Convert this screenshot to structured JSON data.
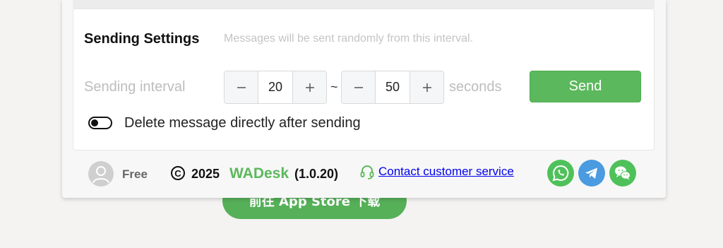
{
  "background": {
    "store_button_label": "前往 App Store 下载"
  },
  "settings": {
    "title": "Sending Settings",
    "subtitle": "Messages will be sent randomly from this interval.",
    "interval_label": "Sending interval",
    "min_value": "20",
    "max_value": "50",
    "separator": "~",
    "unit": "seconds",
    "send_label": "Send",
    "delete_toggle_label": "Delete message directly after sending",
    "delete_toggle_on": false
  },
  "footer": {
    "plan": "Free",
    "year": "2025",
    "brand": "WADesk",
    "version": "(1.0.20)",
    "contact_label": "Contact customer service",
    "social_icons": [
      "whatsapp-icon",
      "telegram-icon",
      "wechat-icon"
    ]
  },
  "colors": {
    "accent_green": "#5cb85c",
    "whatsapp": "#4fc15a",
    "telegram": "#4a9be0",
    "wechat": "#4fc15a",
    "link": "#0000ee"
  }
}
